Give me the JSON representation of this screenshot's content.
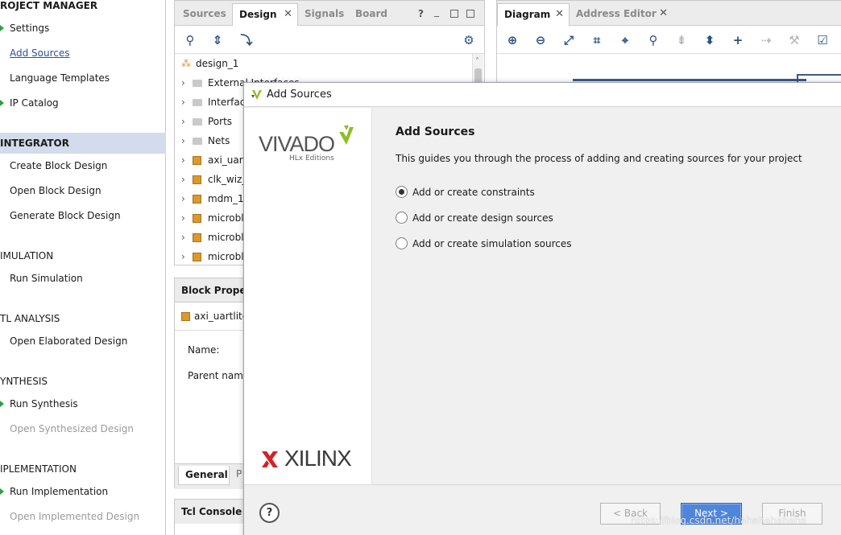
{
  "flow_navigator": {
    "project_manager": "ROJECT MANAGER",
    "settings": "Settings",
    "add_sources": "Add Sources",
    "language_templates": "Language Templates",
    "ip_catalog": "IP Catalog",
    "ip_integrator": "INTEGRATOR",
    "create_block_design": "Create Block Design",
    "open_block_design": "Open Block Design",
    "generate_block_design": "Generate Block Design",
    "simulation": "IMULATION",
    "run_simulation": "Run Simulation",
    "rtl_analysis": "TL ANALYSIS",
    "open_elaborated_design": "Open Elaborated Design",
    "synthesis": "YNTHESIS",
    "run_synthesis": "Run Synthesis",
    "open_synthesized_design": "Open Synthesized Design",
    "implementation": "IPLEMENTATION",
    "run_implementation": "Run Implementation",
    "open_implemented_design": "Open Implemented Design"
  },
  "sources_panel": {
    "tabs": [
      "Sources",
      "Design",
      "Signals",
      "Board"
    ],
    "help_label": "?",
    "tree_root": "design_1",
    "tree_items": [
      "External Interfaces",
      "Interfac",
      "Ports",
      "Nets",
      "axi_uar",
      "clk_wiz_",
      "mdm_1",
      "microbl",
      "microbl",
      "microbl"
    ]
  },
  "block_properties": {
    "title": "Block Propert",
    "selected": "axi_uartlite_",
    "name_label": "Name:",
    "parent_label": "Parent name",
    "tabs": [
      "General",
      "P"
    ]
  },
  "tcl_console": {
    "title": "Tcl Console"
  },
  "diagram_panel": {
    "tabs": [
      "Diagram",
      "Address Editor"
    ]
  },
  "dialog": {
    "window_title": "Add Sources",
    "vivado_logo": "VIVADO",
    "vivado_sub": "HLx Editions",
    "xilinx_logo": "XILINX",
    "heading": "Add Sources",
    "description": "This guides you through the process of adding and creating sources for your project",
    "options": [
      "Add or create constraints",
      "Add or create design sources",
      "Add or create simulation sources"
    ],
    "selected_option": "Add or create constraints",
    "buttons": {
      "help": "?",
      "back": "< Back",
      "next": "Next >",
      "finish": "Finish"
    }
  },
  "watermark": "https://blog.csdn.net/hahahahahaha",
  "colors": {
    "accent": "#4f86dc",
    "section_highlight": "#d2dcec",
    "link": "#2b4f9f",
    "xilinx_red": "#d2232a",
    "vivado_green": "#8cbf26"
  }
}
